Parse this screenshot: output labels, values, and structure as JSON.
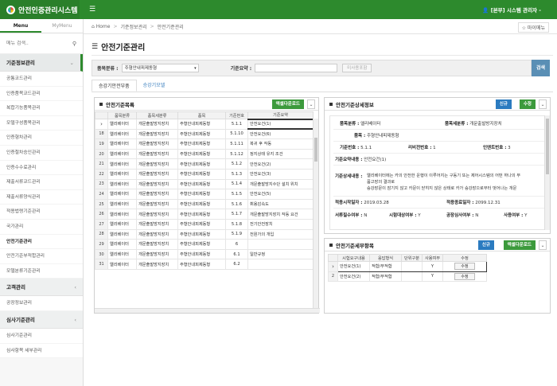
{
  "app": {
    "title": "안전인증관리시스템",
    "user": "[본부] 시스템 관리자 -"
  },
  "sidebar": {
    "tabs": [
      {
        "label": "Menu"
      },
      {
        "label": "MyMenu"
      }
    ],
    "search_placeholder": "메뉴 검색..",
    "groups": [
      {
        "label": "기준정보관리"
      },
      {
        "label": "고객관리"
      },
      {
        "label": "심사기준관리"
      }
    ],
    "items1": [
      "공통코드관리",
      "인증품목코드관리",
      "복합기능품목관리",
      "모델구성품목관리",
      "인증형차관리",
      "인증절차승인관리",
      "인증수수료관리",
      "제출서류코드관리",
      "제출서류양식관리",
      "적용법령기준관리",
      "국가관리",
      "안전기준관리",
      "안전기준부적합관리",
      "모델분류기준관리"
    ],
    "items2": [
      "공장정보관리"
    ],
    "items3": [
      "심사기준관리",
      "심사항목 세부관리"
    ]
  },
  "breadcrumb": {
    "home": "Home",
    "level1": "기준정보관리",
    "level2": "안전기준관리",
    "favorite": "☆ 마이메뉴"
  },
  "page": {
    "title": "안전기준관리"
  },
  "filter": {
    "category_label": "품목분류 :",
    "category_value": "주형안내피제동형",
    "requirement_label": "기준요약 :",
    "requirement_value": "",
    "unregistered_label": "미사용포함",
    "search_label": "검색"
  },
  "tabs": [
    {
      "label": "승강기안전부품"
    },
    {
      "label": "승강기모델"
    }
  ],
  "list_panel": {
    "title": "안전기준목록",
    "excel_label": "엑셀다운로드",
    "columns": [
      "품목분류",
      "품목세분류",
      "품목",
      "기준번호",
      "기준요약"
    ],
    "rows": [
      {
        "no": "",
        "c1": "엘리베이터",
        "c2": "개문출발방지장치",
        "c3": "주형안내피제동형",
        "c4": "5.1.1",
        "c5": "안전요건(1)"
      },
      {
        "no": "18",
        "c1": "엘리베이터",
        "c2": "개문출발방지장치",
        "c3": "주형안내피제동형",
        "c4": "5.1.10",
        "c5": "안전요건(6)"
      },
      {
        "no": "19",
        "c1": "엘리베이터",
        "c2": "개문출발방지장치",
        "c3": "주형안내피제동형",
        "c4": "5.1.11",
        "c5": "복귀 후 작동"
      },
      {
        "no": "20",
        "c1": "엘리베이터",
        "c2": "개문출발방지장치",
        "c3": "주형안내피제동형",
        "c4": "5.1.12",
        "c5": "정지상태 유지 조건"
      },
      {
        "no": "21",
        "c1": "엘리베이터",
        "c2": "개문출발방지장치",
        "c3": "주형안내피제동형",
        "c4": "5.1.2",
        "c5": "안전요건(2)"
      },
      {
        "no": "22",
        "c1": "엘리베이터",
        "c2": "개문출발방지장치",
        "c3": "주형안내피제동형",
        "c4": "5.1.3",
        "c5": "안전요건(3)"
      },
      {
        "no": "23",
        "c1": "엘리베이터",
        "c2": "개문출발방지장치",
        "c3": "주형안내피제동형",
        "c4": "5.1.4",
        "c5": "개문출발방지수단 설치 위치"
      },
      {
        "no": "24",
        "c1": "엘리베이터",
        "c2": "개문출발방지장치",
        "c3": "주형안내피제동형",
        "c4": "5.1.5",
        "c5": "안전요건(5)"
      },
      {
        "no": "25",
        "c1": "엘리베이터",
        "c2": "개문출발방지장치",
        "c3": "주형안내피제동형",
        "c4": "5.1.6",
        "c5": "휘용감속도"
      },
      {
        "no": "26",
        "c1": "엘리베이터",
        "c2": "개문출발방지장치",
        "c3": "주형안내피제동형",
        "c4": "5.1.7",
        "c5": "개문출발방지장치 작동 요건"
      },
      {
        "no": "27",
        "c1": "엘리베이터",
        "c2": "개문출발방지장치",
        "c3": "주형안내피제동형",
        "c4": "5.1.8",
        "c5": "전기안전장치"
      },
      {
        "no": "28",
        "c1": "엘리베이터",
        "c2": "개문출발방지장치",
        "c3": "주형안내피제동형",
        "c4": "5.1.9",
        "c5": "전원가의 개입"
      },
      {
        "no": "29",
        "c1": "엘리베이터",
        "c2": "개문출발방지장치",
        "c3": "주형안내피제동형",
        "c4": "6",
        "c5": ""
      },
      {
        "no": "30",
        "c1": "엘리베이터",
        "c2": "개문출발방지장치",
        "c3": "주형안내피제동형",
        "c4": "6.1",
        "c5": "일반규정"
      },
      {
        "no": "31",
        "c1": "엘리베이터",
        "c2": "개문출발방지장치",
        "c3": "주형안내피제동형",
        "c4": "6.2",
        "c5": ""
      }
    ]
  },
  "detail_panel": {
    "title": "안전기준상세정보",
    "new_label": "신규",
    "edit_label": "수정",
    "category_label": "품목분류 :",
    "category": "엘리베이터",
    "subcategory_label": "품목세분류 :",
    "subcategory": "개문출발방지장치",
    "item_label": "품목 :",
    "item": "주형안내피제동형",
    "std_no_label": "기준번호 :",
    "std_no": "5.1.1",
    "rev_no_label": "리비전번호 :",
    "rev_no": "1",
    "sort_no_label": "인덴트번호 :",
    "sort_no": "3",
    "summary_label": "기준요약내용 :",
    "summary": "안전요건(1)",
    "detail_label": "기준상세내용 :",
    "detail_line1": "엘리베이터에는 카의 안전한 운행이 이루어지는 구동기 또는 제어시스템의 어떤 하나의 부",
    "detail_line2": "품고장의 결과로",
    "detail_line3": "승강장문이 잠기지 않고 카문이 닫히지 않은 상태로 카가 승강장으로부터 벗어나는 개문",
    "start_label": "적용시작일자 :",
    "start": "2019.03.28",
    "end_label": "적용종료일자 :",
    "end": "2099.12.31",
    "doc_label": "서류필수여부 :",
    "doc": "N",
    "test_label": "시험대상여부 :",
    "test": "Y",
    "factory_label": "공장심사여부 :",
    "factory": "N",
    "use_label": "사용여부 :",
    "use": "Y"
  },
  "sub_panel": {
    "title": "안전기준세부항목",
    "new_label": "신규",
    "excel_label": "엑셀다운로드",
    "columns": [
      "시험요구내용",
      "응답형식",
      "단위구분",
      "사용여부",
      "수정"
    ],
    "rows": [
      {
        "no": "",
        "c1": "안전요건(1)",
        "c2": "적합/부적합",
        "c3": "",
        "c4": "Y",
        "c5": "수정"
      },
      {
        "no": "2",
        "c1": "안전요건(2)",
        "c2": "적합/부적합",
        "c3": "",
        "c4": "Y",
        "c5": "수정"
      }
    ]
  }
}
